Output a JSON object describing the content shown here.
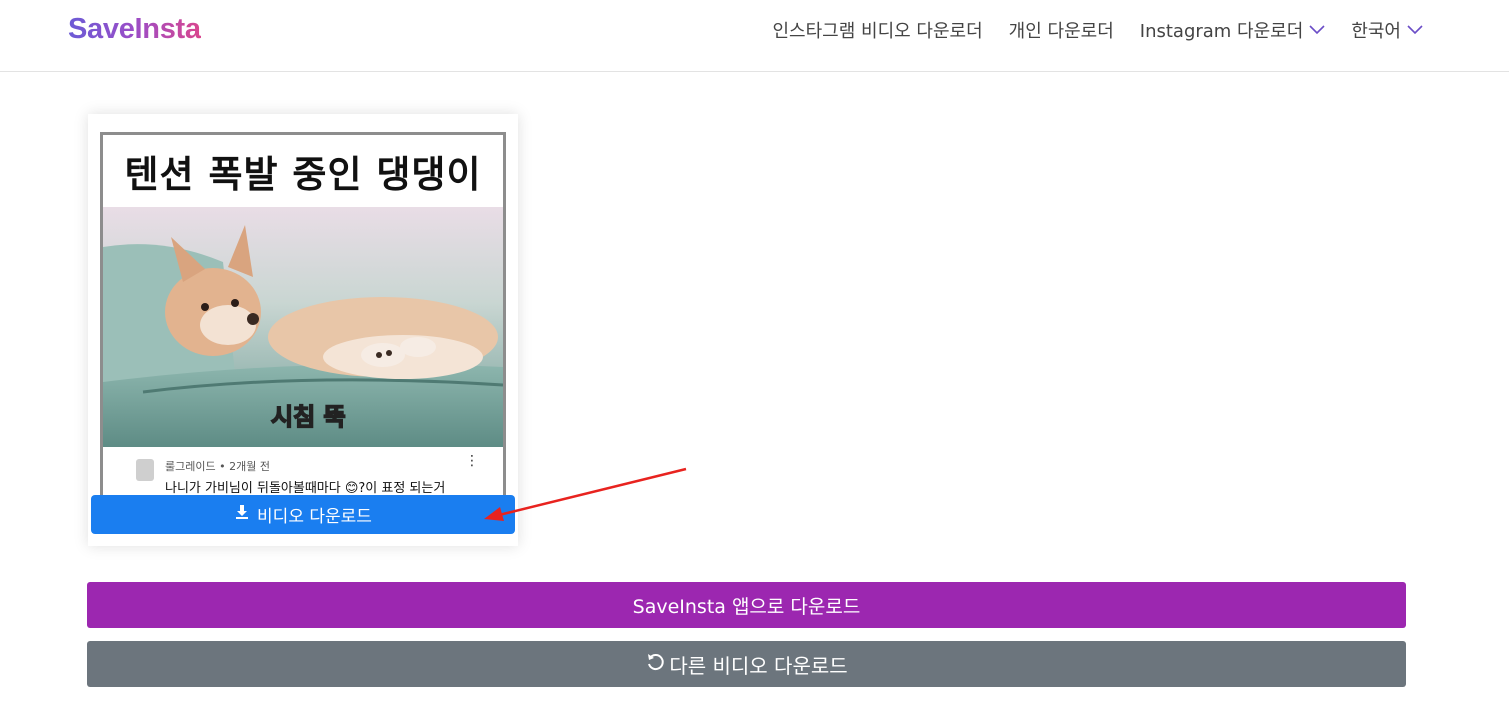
{
  "header": {
    "logo": "SaveInsta",
    "nav": [
      {
        "label": "인스타그램 비디오 다운로더"
      },
      {
        "label": "개인 다운로더"
      },
      {
        "label": "Instagram 다운로더",
        "has_dropdown": true
      },
      {
        "label": "한국어",
        "has_dropdown": true
      }
    ]
  },
  "preview": {
    "thumbnail_title": "텐션 폭발 중인 댕댕이",
    "caption_meta": "룰그레이드 • 2개월 전",
    "caption_text": "나니가 가비님이 뒤돌아볼때마다 😊?이 표정 되는거",
    "overlay_text": "시침 뚝",
    "download_button": "비디오 다운로드"
  },
  "buttons": {
    "app_download": "SaveInsta 앱으로 다운로드",
    "other_download": "다른 비디오 다운로드"
  },
  "colors": {
    "primary_blue": "#1a7ef0",
    "purple": "#9c27b0",
    "gray": "#6c757d",
    "annotation_arrow": "#e8231f"
  }
}
